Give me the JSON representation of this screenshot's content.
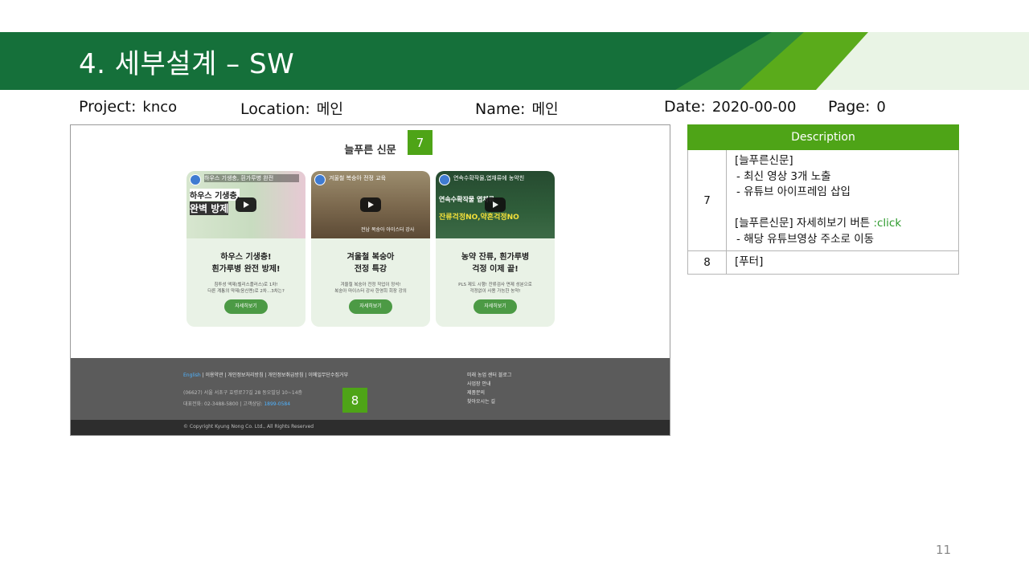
{
  "slide": {
    "title": "4.  세부설계 – SW",
    "page_number": "11"
  },
  "meta": {
    "project_label": "Project:",
    "project_value": "knco",
    "location_label": "Location:",
    "location_value": "메인",
    "name_label": "Name:",
    "name_value": "메인",
    "date_label": "Date:",
    "date_value": "2020-00-00",
    "page_label": "Page:",
    "page_value": "0"
  },
  "mockup": {
    "section_title": "늘푸른 신문",
    "marker_7": "7",
    "marker_8": "8",
    "cards": [
      {
        "video_title": "하우스 기생충, 흰가루병 완전",
        "caption_1": "하우스 기생충,",
        "caption_2": "완벽 방제",
        "heading_1": "하우스 기생충!",
        "heading_2": "흰가루병 완전 방제!",
        "desc_1": "침투성 액제(벨리스플러스)로 1차!",
        "desc_2": "다른 계통의 약제(응신멘)로 2차...3차는?",
        "button": "자세히보기",
        "thumb_color": "#c7d7c0"
      },
      {
        "video_title": "겨울철 복숭아 전정 교육",
        "caption_1": "전남 복숭아 아이스터 강사",
        "caption_2": "",
        "heading_1": "겨울철 복숭아",
        "heading_2": "전정 특강",
        "desc_1": "겨울철 복숭아 전정 작업이 정석!",
        "desc_2": "복숭아 마이스터 강사 한영희 회장 강의",
        "button": "자세히보기",
        "thumb_color": "#7d6a4f"
      },
      {
        "video_title": "연속수확작물,엽채류에 농약친",
        "caption_1": "연속수확작물 엽채류",
        "caption_2": "잔류걱정NO,약흔걱정NO",
        "heading_1": "농약 잔류, 흰가루병",
        "heading_2": "걱정 이제 끝!",
        "desc_1": "PLS 제도 시행! 잔류검사 면제 성분으로",
        "desc_2": "걱정없이 사용 가능한 농약!",
        "button": "자세히보기",
        "thumb_color": "#2f5e3a"
      }
    ],
    "footer": {
      "link_en": "English",
      "links": "  |  이용약관  |  개인정보처리방침  |  개인정보취급방침  |  이메일무단수집거부",
      "address": "(06627) 서울 서초구 효령로77길 28 동오빌딩 10~14층",
      "tel_prefix": "대표전화: 02-3488-5800  |  고객상담: ",
      "tel_highlight": "1899-0584",
      "right_links": [
        "미래 농업 센터 블로그",
        "사업장 안내",
        "제품문의",
        "찾아오시는 길"
      ],
      "copyright": "© Copyright Kyung Nong Co. Ltd., All Rights Reserved"
    }
  },
  "description_table": {
    "header": "Description",
    "rows": [
      {
        "num": "7",
        "lines": [
          "[늘푸른신문]",
          "-   최신 영상 3개 노출",
          "-   유튜브 아이프레임 삽입",
          "",
          "[늘푸른신문]  자세히보기 버튼 ",
          "-   해당 유튜브영상 주소로 이동"
        ],
        "click_suffix": ":click"
      },
      {
        "num": "8",
        "lines": [
          "[푸터]"
        ]
      }
    ]
  },
  "colors": {
    "banner_green": "#1a7a3c",
    "accent_green": "#4ea417",
    "light_green": "#eaf4e2"
  }
}
